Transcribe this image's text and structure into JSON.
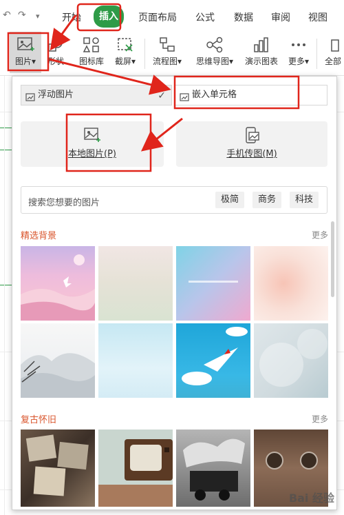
{
  "quick_access": {
    "undo_icon": "undo-icon",
    "redo_icon": "redo-icon",
    "customize_icon": "chevron-down-icon"
  },
  "tabs": [
    {
      "label": "开始",
      "active": false
    },
    {
      "label": "插入",
      "active": true
    },
    {
      "label": "页面布局",
      "active": false
    },
    {
      "label": "公式",
      "active": false
    },
    {
      "label": "数据",
      "active": false
    },
    {
      "label": "审阅",
      "active": false
    },
    {
      "label": "视图",
      "active": false
    }
  ],
  "toolbar": {
    "picture": "图片",
    "shape": "形状",
    "icon_library": "图标库",
    "screenshot": "截屏",
    "flowchart": "流程图",
    "mindmap": "思维导图",
    "chart": "演示图表",
    "more": "更多",
    "all": "全部"
  },
  "panel": {
    "mode_floating": "浮动图片",
    "mode_embed": "嵌入单元格",
    "local_picture": "本地图片(P)",
    "phone_picture": "手机传图(M)",
    "search_placeholder": "搜索您想要的图片",
    "chips": [
      "极简",
      "商务",
      "科技"
    ],
    "section1_title": "精选背景",
    "section2_title": "复古怀旧",
    "more_label": "更多"
  },
  "watermark": "Bai 经验",
  "colors": {
    "accent_green": "#2e9b47",
    "annotation_red": "#e0251b",
    "section_title": "#d9542b"
  }
}
